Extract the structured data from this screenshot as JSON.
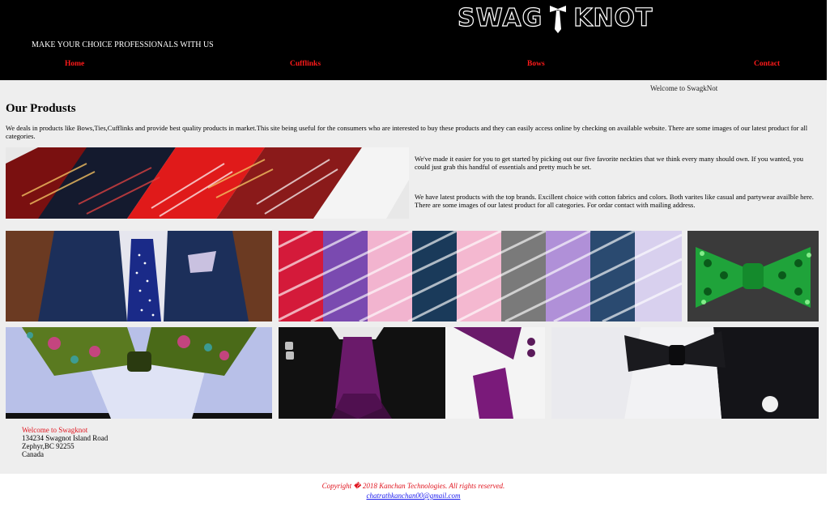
{
  "header": {
    "logo_left": "SWAG",
    "logo_right": "KNOT",
    "tagline": "MAKE YOUR CHOICE PROFESSIONALS WITH US"
  },
  "nav": {
    "home": "Home",
    "cufflinks": "Cufflinks",
    "bows": "Bows",
    "contact": "Contact"
  },
  "main": {
    "welcome": "Welcome to SwagkNot",
    "title": "Our Produsts",
    "intro": "We deals in products like Bows,Ties,Cufflinks and provide best quality products in market.This site being useful for the consumers who are interested to buy these products and they can easily access online by checking on available website. There are some images of our latest product for all categories.",
    "paragraph_1": "We've made it easier for you to get started by picking out our five favorite neckties that we think every many should own. If you wanted, you could just grab this handful of essentials and pretty much be set.",
    "paragraph_2": "We have latest products with the top brands. Excillent choice with cotton fabrics and colors. Both varites like casual and partywear availble here. There are some images of our latest product for all categories. For ordar contact with mailing address."
  },
  "address": {
    "welcome": "Welcome to Swagknot",
    "line1": "134234 Swagnot Island Road",
    "line2": "Zephyr,BC 92255",
    "line3": "Canada"
  },
  "footer": {
    "copyright": "Copyright � 2018 Kanchan Technologies. All rights reserved.",
    "email": "chatrathkanchan00@gmail.com"
  },
  "colors": {
    "header_bg": "#000000",
    "nav_link": "#ff1a1a",
    "content_bg": "#eeeeee",
    "accent_red": "#e0141e",
    "link_blue": "#1a1aee"
  }
}
